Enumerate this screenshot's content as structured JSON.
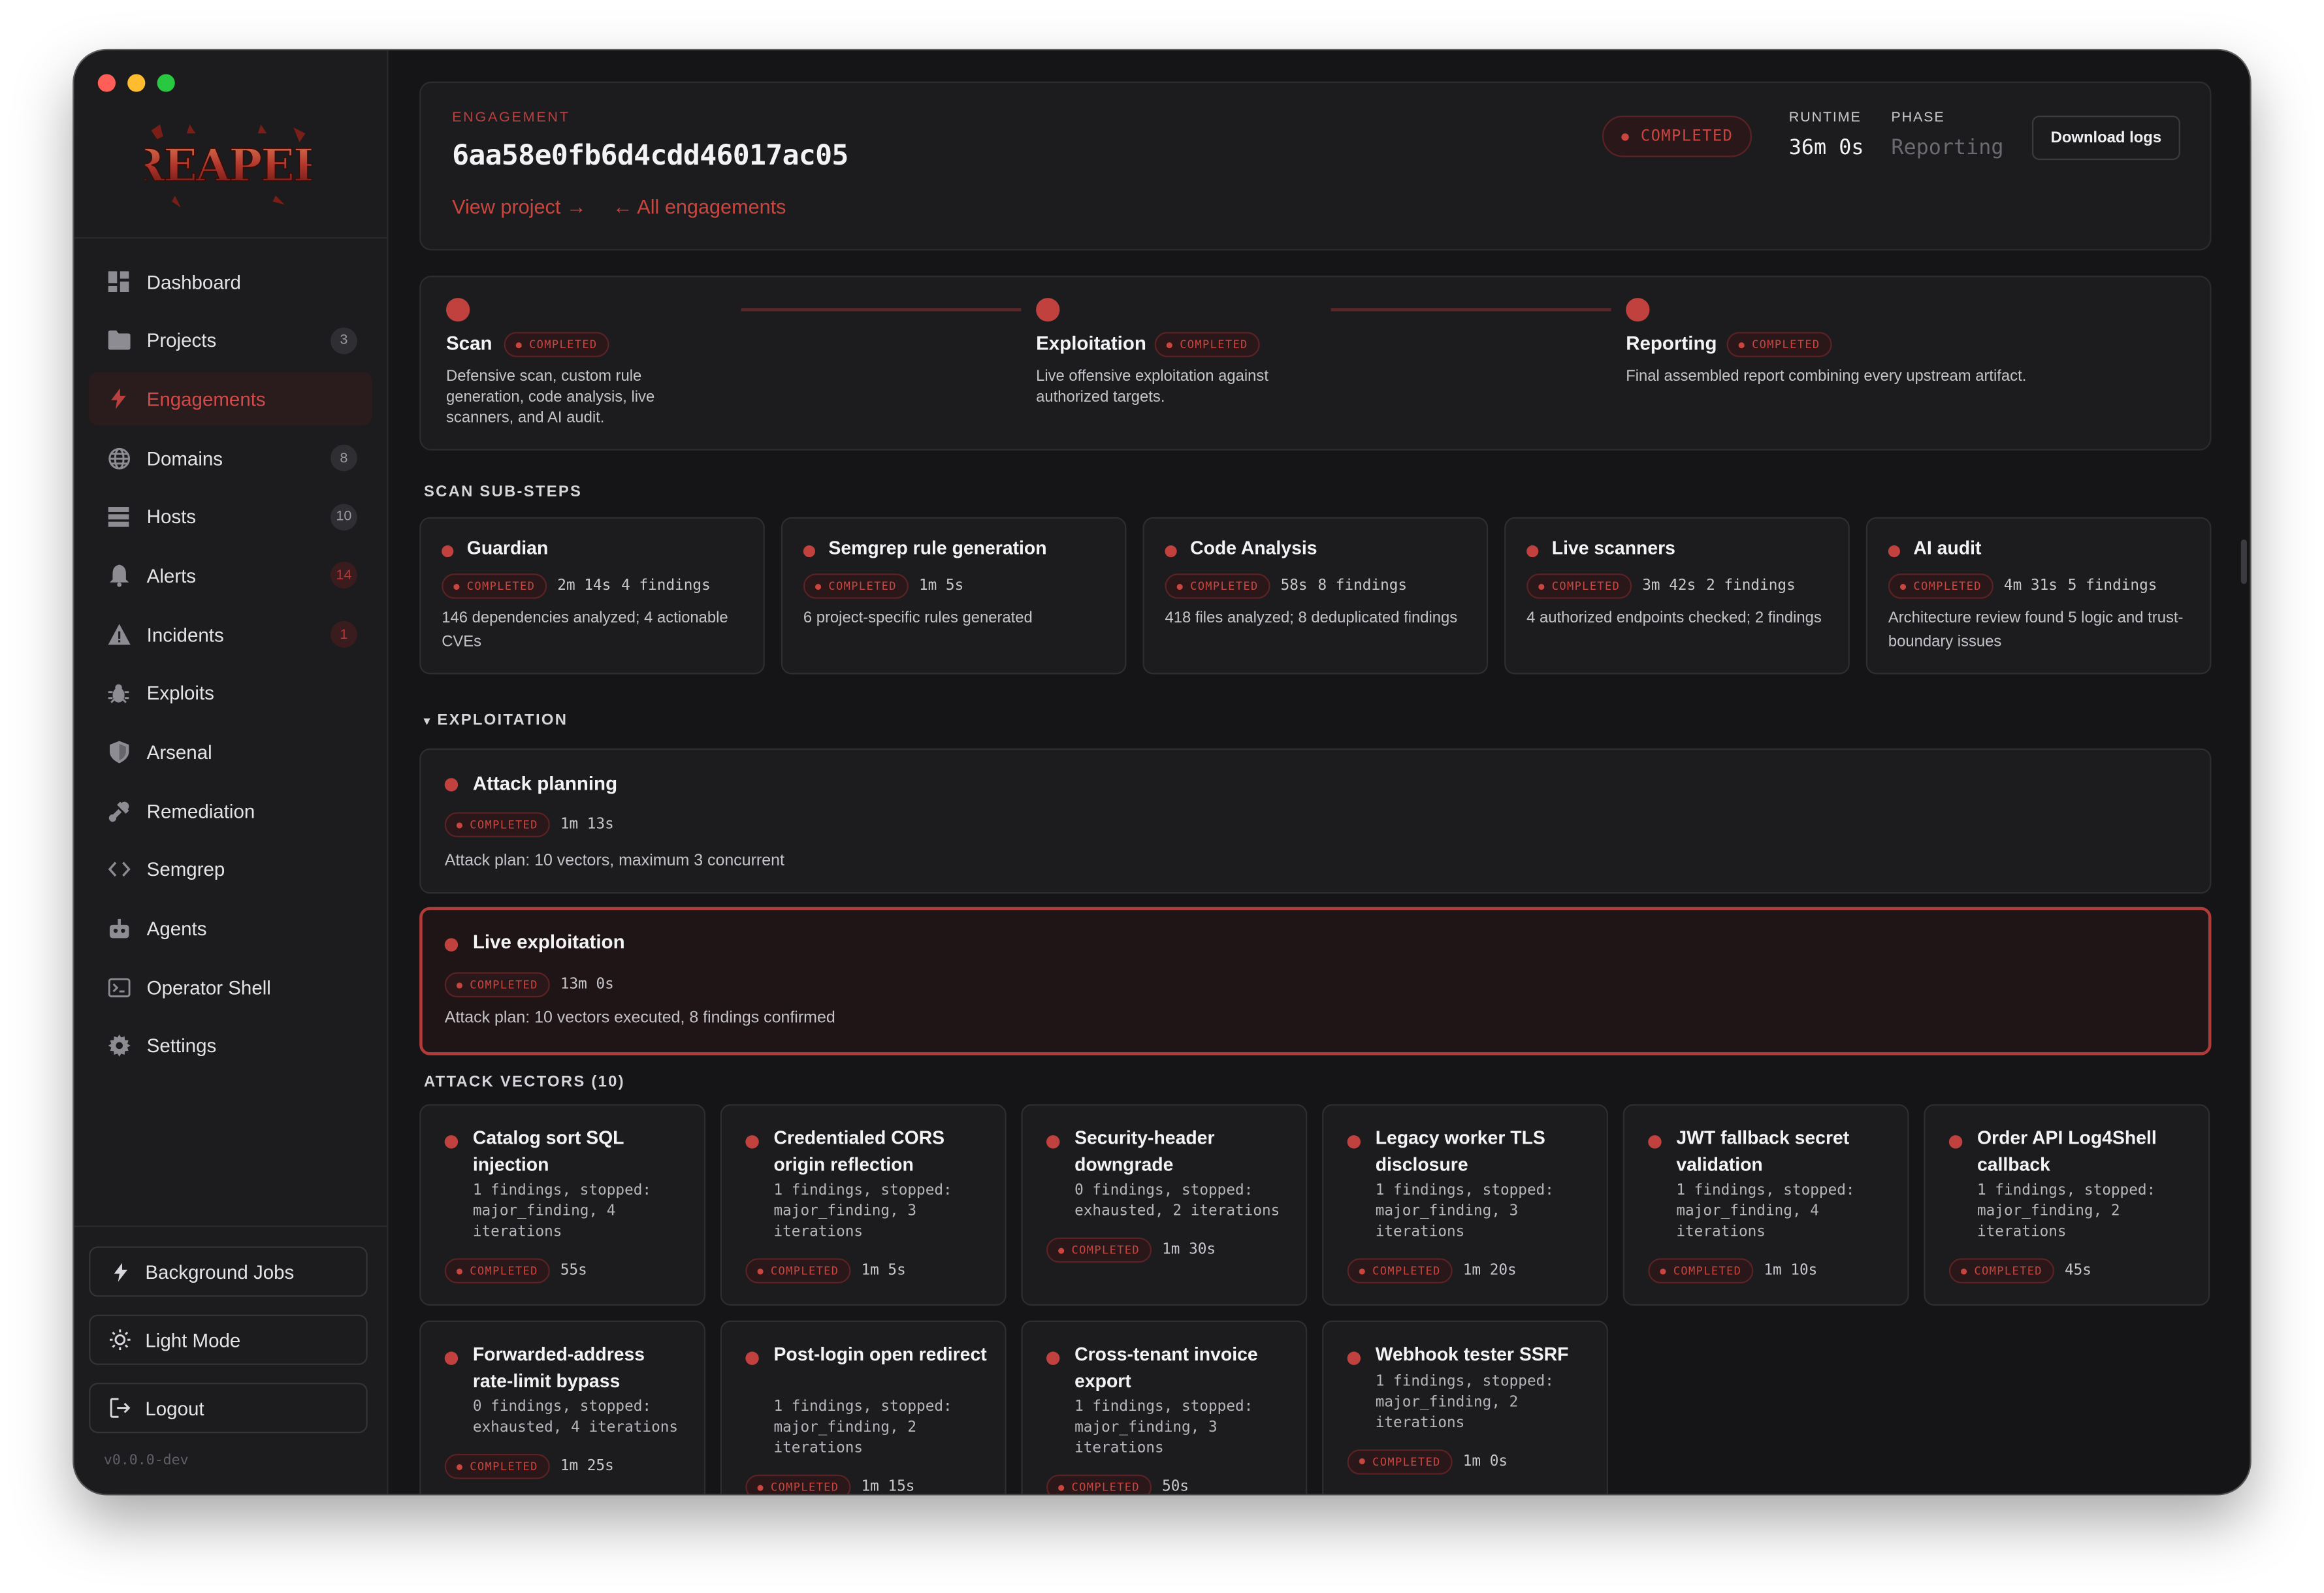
{
  "window": {
    "traffic": [
      "close",
      "minimize",
      "zoom"
    ]
  },
  "logo": {
    "text": "REAPER"
  },
  "sidebar": {
    "items": [
      {
        "label": "Dashboard",
        "icon": "dashboard-icon",
        "badge": ""
      },
      {
        "label": "Projects",
        "icon": "folder-icon",
        "badge": "3"
      },
      {
        "label": "Engagements",
        "icon": "bolt-icon",
        "badge": "",
        "active": true
      },
      {
        "label": "Domains",
        "icon": "globe-icon",
        "badge": "8"
      },
      {
        "label": "Hosts",
        "icon": "server-icon",
        "badge": "10"
      },
      {
        "label": "Alerts",
        "icon": "bell-icon",
        "badge": "14"
      },
      {
        "label": "Incidents",
        "icon": "warning-icon",
        "badge": "1"
      },
      {
        "label": "Exploits",
        "icon": "bug-icon",
        "badge": ""
      },
      {
        "label": "Arsenal",
        "icon": "shield-icon",
        "badge": ""
      },
      {
        "label": "Remediation",
        "icon": "wrench-icon",
        "badge": ""
      },
      {
        "label": "Semgrep",
        "icon": "code-icon",
        "badge": ""
      },
      {
        "label": "Agents",
        "icon": "robot-icon",
        "badge": ""
      },
      {
        "label": "Operator Shell",
        "icon": "terminal-icon",
        "badge": ""
      },
      {
        "label": "Settings",
        "icon": "gear-icon",
        "badge": ""
      }
    ],
    "background_jobs": "Background Jobs",
    "light_mode": "Light Mode",
    "logout": "Logout",
    "version": "v0.0.0-dev"
  },
  "engagement": {
    "label": "ENGAGEMENT",
    "id": "6aa58e0fb6d4cdd46017ac05",
    "view_project": "View project →",
    "all_engagements": "← All engagements",
    "status": "COMPLETED",
    "runtime_label": "RUNTIME",
    "runtime_value": "36m 0s",
    "phase_label": "PHASE",
    "phase_value": "Reporting",
    "download_logs": "Download logs"
  },
  "phases": [
    {
      "title": "Scan",
      "status": "COMPLETED",
      "desc": "Defensive scan, custom rule generation, code analysis, live scanners, and AI audit."
    },
    {
      "title": "Exploitation",
      "status": "COMPLETED",
      "desc": "Live offensive exploitation against authorized targets."
    },
    {
      "title": "Reporting",
      "status": "COMPLETED",
      "desc": "Final assembled report combining every upstream artifact."
    }
  ],
  "scan_substeps": {
    "heading": "SCAN SUB-STEPS",
    "items": [
      {
        "title": "Guardian",
        "status": "COMPLETED",
        "time": "2m 14s",
        "findings": "4 findings",
        "desc": "146 dependencies analyzed; 4 actionable CVEs"
      },
      {
        "title": "Semgrep rule generation",
        "status": "COMPLETED",
        "time": "1m 5s",
        "findings": "",
        "desc": "6 project-specific rules generated"
      },
      {
        "title": "Code Analysis",
        "status": "COMPLETED",
        "time": "58s",
        "findings": "8 findings",
        "desc": "418 files analyzed; 8 deduplicated findings"
      },
      {
        "title": "Live scanners",
        "status": "COMPLETED",
        "time": "3m 42s",
        "findings": "2 findings",
        "desc": "4 authorized endpoints checked; 2 findings"
      },
      {
        "title": "AI audit",
        "status": "COMPLETED",
        "time": "4m 31s",
        "findings": "5 findings",
        "desc": "Architecture review found 5 logic and trust-boundary issues"
      }
    ]
  },
  "exploitation": {
    "heading": "EXPLOITATION",
    "items": [
      {
        "title": "Attack planning",
        "status": "COMPLETED",
        "time": "1m 13s",
        "desc": "Attack plan: 10 vectors, maximum 3 concurrent"
      },
      {
        "title": "Live exploitation",
        "status": "COMPLETED",
        "time": "13m 0s",
        "desc": "Attack plan: 10 vectors executed, 8 findings confirmed"
      }
    ]
  },
  "attack_vectors": {
    "heading": "ATTACK VECTORS (10)",
    "items": [
      {
        "title": "Catalog sort SQL injection",
        "detail": "1 findings, stopped: major_finding, 4 iterations",
        "status": "COMPLETED",
        "time": "55s"
      },
      {
        "title": "Credentialed CORS origin reflection",
        "detail": "1 findings, stopped: major_finding, 3 iterations",
        "status": "COMPLETED",
        "time": "1m 5s"
      },
      {
        "title": "Security-header downgrade",
        "detail": "0 findings, stopped: exhausted, 2 iterations",
        "status": "COMPLETED",
        "time": "1m 30s"
      },
      {
        "title": "Legacy worker TLS disclosure",
        "detail": "1 findings, stopped: major_finding, 3 iterations",
        "status": "COMPLETED",
        "time": "1m 20s"
      },
      {
        "title": "JWT fallback secret validation",
        "detail": "1 findings, stopped: major_finding, 4 iterations",
        "status": "COMPLETED",
        "time": "1m 10s"
      },
      {
        "title": "Order API Log4Shell callback",
        "detail": "1 findings, stopped: major_finding, 2 iterations",
        "status": "COMPLETED",
        "time": "45s"
      },
      {
        "title": "Forwarded-address rate-limit bypass",
        "detail": "0 findings, stopped: exhausted, 4 iterations",
        "status": "COMPLETED",
        "time": "1m 25s"
      },
      {
        "title": "Post-login open redirect",
        "detail": "1 findings, stopped: major_finding, 2 iterations",
        "status": "COMPLETED",
        "time": "1m 15s"
      },
      {
        "title": "Cross-tenant invoice export",
        "detail": "1 findings, stopped: major_finding, 3 iterations",
        "status": "COMPLETED",
        "time": "50s"
      },
      {
        "title": "Webhook tester SSRF",
        "detail": "1 findings, stopped: major_finding, 2 iterations",
        "status": "COMPLETED",
        "time": "1m 0s"
      }
    ]
  },
  "colors": {
    "accent": "#c0413e",
    "background": "#151517",
    "panel": "#1c1c1f"
  }
}
